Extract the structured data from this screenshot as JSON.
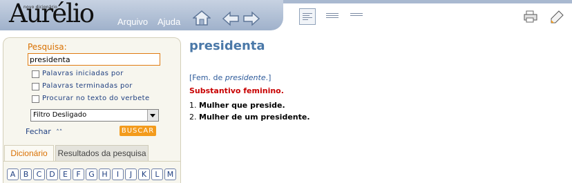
{
  "app": {
    "logo_small": "novo dicionário",
    "logo": "Aurélio",
    "menu": {
      "arquivo": "Arquivo",
      "ajuda": "Ajuda"
    }
  },
  "search": {
    "label": "Pesquisa:",
    "value": "presidenta",
    "options": [
      "Palavras iniciadas por",
      "Palavras terminadas por",
      "Procurar no texto do verbete"
    ],
    "filter": "Filtro Desligado",
    "close": "Fechar",
    "button": "BUSCAR"
  },
  "tabs": [
    "Dicionário",
    "Resultados da pesquisa"
  ],
  "letters": [
    "A",
    "B",
    "C",
    "D",
    "E",
    "F",
    "G",
    "H",
    "I",
    "J",
    "K",
    "L",
    "M"
  ],
  "entry": {
    "headword": "presidenta",
    "etym_prefix": "[Fem. de ",
    "etym_word": "presidente",
    "etym_suffix": ".]",
    "grammar": "Substantivo feminino.",
    "defs": [
      {
        "n": "1.",
        "text": "Mulher que preside."
      },
      {
        "n": "2.",
        "text": "Mulher de um presidente."
      }
    ]
  },
  "colors": {
    "accent": "#f39b1c",
    "headword": "#4a78a8",
    "grammar": "#c80000",
    "link": "#1f3f80"
  }
}
